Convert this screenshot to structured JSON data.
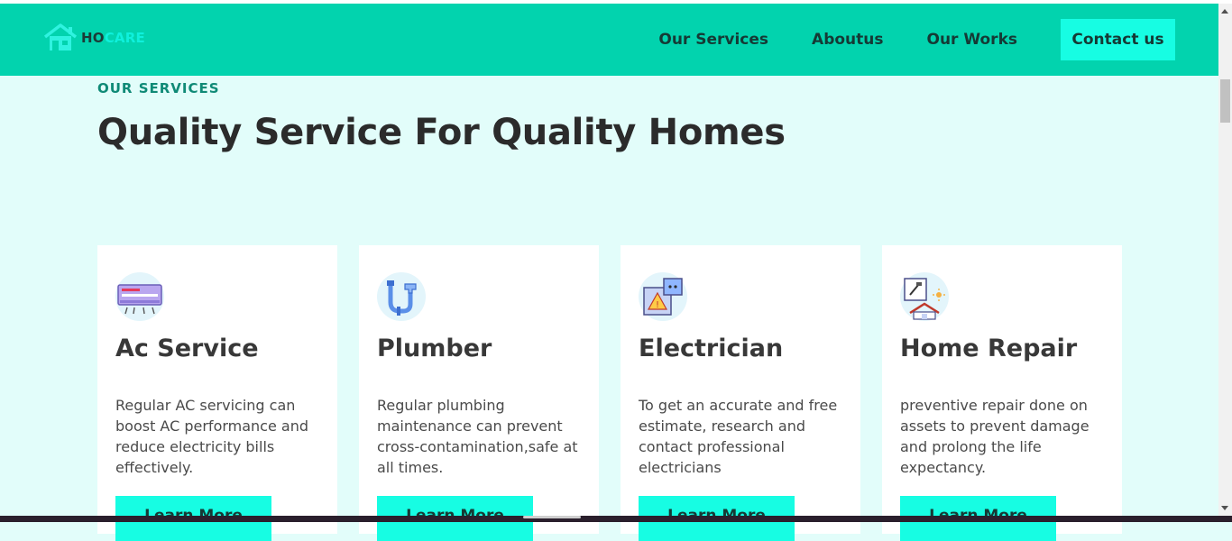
{
  "brand": {
    "logo_ho": "HO",
    "logo_care": "CARE",
    "logo_icon": "house-icon"
  },
  "nav": {
    "items": [
      "Our Services",
      "Aboutus",
      "Our Works"
    ],
    "contact_label": "Contact us"
  },
  "section": {
    "eyebrow": "OUR SERVICES",
    "title": "Quality Service For Quality Homes"
  },
  "cards": [
    {
      "title": "Ac Service",
      "icon": "air-conditioner-icon",
      "text": "Regular AC servicing can boost AC performance and reduce electricity bills effectively.",
      "button": "Learn More"
    },
    {
      "title": "Plumber",
      "icon": "pipe-icon",
      "text": "Regular plumbing maintenance can prevent cross-contamination,safe at all times.",
      "button": "Learn More"
    },
    {
      "title": "Electrician",
      "icon": "electrical-hazard-icon",
      "text": "To get an accurate and free estimate, research and contact professional electricians",
      "button": "Learn More"
    },
    {
      "title": "Home Repair",
      "icon": "home-repair-icon",
      "text": "preventive repair done on assets to prevent damage and prolong the life expectancy.",
      "button": "Learn More"
    }
  ],
  "colors": {
    "header": "#02d3ae",
    "accent": "#17fde3",
    "background": "#e2fdfa",
    "eyebrow": "#0f8a76"
  }
}
